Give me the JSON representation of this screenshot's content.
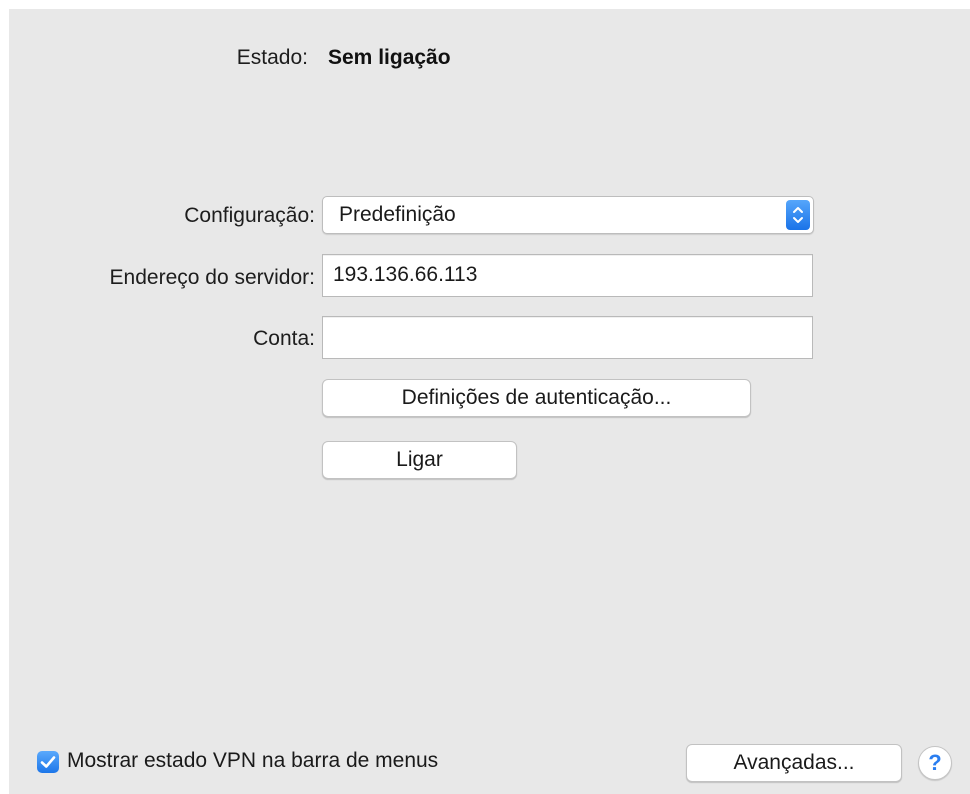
{
  "status": {
    "label": "Estado:",
    "value": "Sem ligação"
  },
  "form": {
    "configuration": {
      "label": "Configuração:",
      "selected": "Predefinição"
    },
    "server_address": {
      "label": "Endereço do servidor:",
      "value": "193.136.66.113"
    },
    "account": {
      "label": "Conta:",
      "value": ""
    },
    "auth_settings_button": "Definições de autenticação...",
    "connect_button": "Ligar"
  },
  "footer": {
    "show_vpn_status": {
      "label": "Mostrar estado VPN na barra de menus",
      "checked": true
    },
    "advanced_button": "Avançadas...",
    "help_button": "?"
  },
  "colors": {
    "panel_background": "#e8e8e8",
    "accent": "#1d76e9"
  },
  "icons": {
    "popup": "updown-chevron-icon",
    "checkbox": "checkmark-icon",
    "help": "help-icon"
  }
}
